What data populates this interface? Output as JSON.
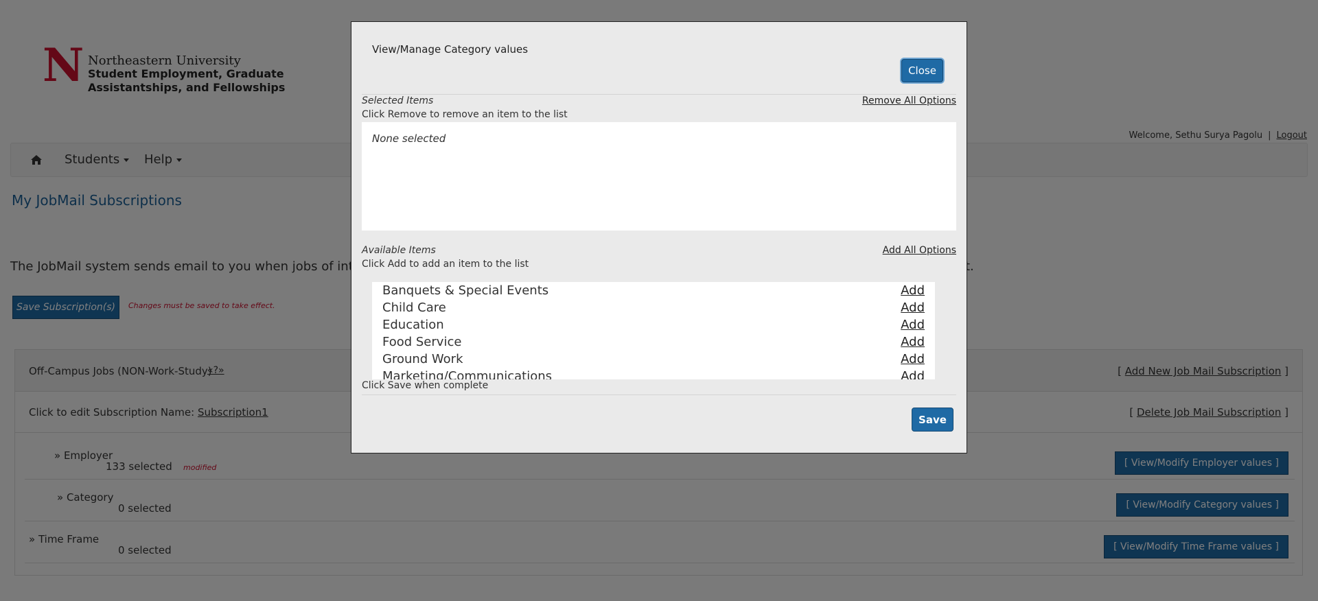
{
  "header": {
    "logo_letter": "N",
    "university": "Northeastern University",
    "department": "Student Employment, Graduate\nAssistantships, and Fellowships",
    "welcome": "Welcome, Sethu Surya Pagolu",
    "separator": "|",
    "logout": "Logout"
  },
  "nav": {
    "home_icon": "home-icon",
    "items": [
      {
        "label": "Students"
      },
      {
        "label": "Help"
      }
    ]
  },
  "page": {
    "title": "My JobMail Subscriptions",
    "intro_visible": "The JobMail system sends email to you when jobs of interest a",
    "intro_tail": "t.",
    "save_subscriptions": "Save Subscription(s)",
    "save_note": "Changes must be saved to take effect."
  },
  "subscription": {
    "type": "Off-Campus Jobs (NON-Work-Study)",
    "help": "«?»",
    "add_new": "Add New Job Mail Subscription",
    "name_label": "Click to edit Subscription Name:",
    "name": "Subscription1",
    "delete": "Delete Job Mail Subscription",
    "bracket_open": "[ ",
    "bracket_close": " ]",
    "rows": [
      {
        "label": "» Employer",
        "count": "133 selected",
        "modified": "modified",
        "button": "[ View/Modify Employer values ]"
      },
      {
        "label": "» Category",
        "count": "0 selected",
        "button": "[ View/Modify Category values ]"
      },
      {
        "label": "» Time Frame",
        "count": "0 selected",
        "button": "[ View/Modify Time Frame values ]"
      }
    ]
  },
  "modal": {
    "title": "View/Manage Category values",
    "close": "Close",
    "selected": {
      "title": "Selected Items",
      "help": "Click Remove to remove an item to the list",
      "remove_all": "Remove All Options",
      "empty": "None selected"
    },
    "available": {
      "title": "Available Items",
      "help": "Click Add to add an item to the list",
      "add_all": "Add All Options",
      "items": [
        {
          "name": "Banquets & Special Events",
          "action": "Add"
        },
        {
          "name": "Child Care",
          "action": "Add"
        },
        {
          "name": "Education",
          "action": "Add"
        },
        {
          "name": "Food Service",
          "action": "Add"
        },
        {
          "name": "Ground Work",
          "action": "Add"
        },
        {
          "name": "Marketing/Communications",
          "action": "Add"
        }
      ]
    },
    "footer_help": "Click Save when complete",
    "save": "Save"
  },
  "colors": {
    "brand_red": "#c8102e",
    "button_blue": "#1f6aa5",
    "link_blue": "#1a5f94"
  }
}
